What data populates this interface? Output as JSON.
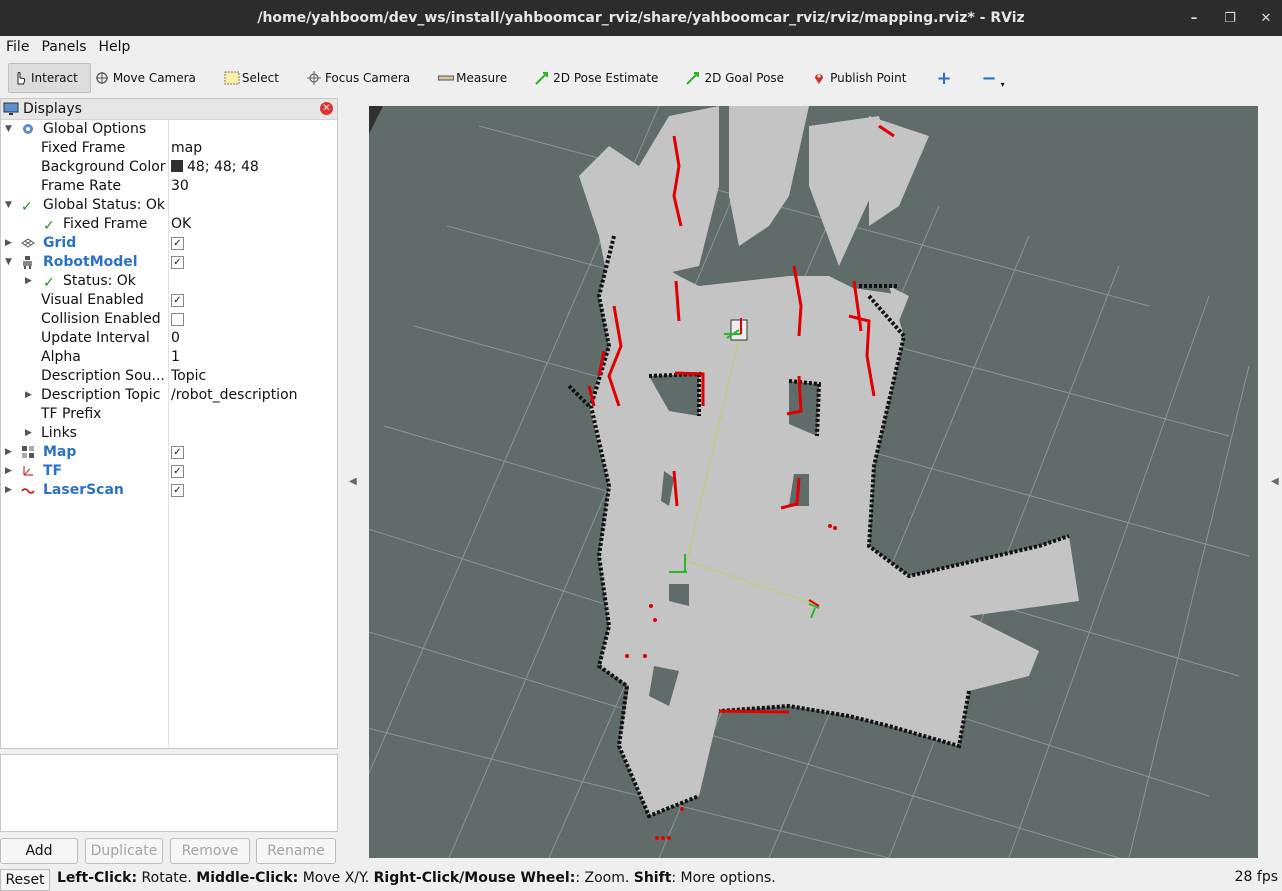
{
  "window": {
    "title": "/home/yahboom/dev_ws/install/yahboomcar_rviz/share/yahboomcar_rviz/rviz/mapping.rviz* - RViz",
    "buttons": {
      "minimize": "–",
      "restore": "❐",
      "close": "✕"
    }
  },
  "menu": [
    "File",
    "Panels",
    "Help"
  ],
  "toolbar": {
    "interact": "Interact",
    "move_camera": "Move Camera",
    "select": "Select",
    "focus_camera": "Focus Camera",
    "measure": "Measure",
    "pose_estimate": "2D Pose Estimate",
    "goal_pose": "2D Goal Pose",
    "publish_point": "Publish Point",
    "plus": "+",
    "minus": "−"
  },
  "displays": {
    "title": "Displays",
    "global_options": {
      "label": "Global Options",
      "fixed_frame_label": "Fixed Frame",
      "fixed_frame_value": "map",
      "bg_label": "Background Color",
      "bg_value": "48; 48; 48",
      "frame_rate_label": "Frame Rate",
      "frame_rate_value": "30"
    },
    "global_status": {
      "label": "Global Status: Ok",
      "fixed_frame_label": "Fixed Frame",
      "fixed_frame_value": "OK"
    },
    "grid": {
      "label": "Grid",
      "checked": true
    },
    "robot_model": {
      "label": "RobotModel",
      "checked": true,
      "status": "Status: Ok",
      "visual_label": "Visual Enabled",
      "visual_checked": true,
      "collision_label": "Collision Enabled",
      "collision_checked": false,
      "update_label": "Update Interval",
      "update_value": "0",
      "alpha_label": "Alpha",
      "alpha_value": "1",
      "desc_source_label": "Description Sou...",
      "desc_source_value": "Topic",
      "desc_topic_label": "Description Topic",
      "desc_topic_value": "/robot_description",
      "tf_prefix_label": "TF Prefix",
      "links_label": "Links"
    },
    "map": {
      "label": "Map",
      "checked": true
    },
    "tf": {
      "label": "TF",
      "checked": true
    },
    "laser_scan": {
      "label": "LaserScan",
      "checked": true
    }
  },
  "panel_buttons": {
    "add": "Add",
    "duplicate": "Duplicate",
    "remove": "Remove",
    "rename": "Rename"
  },
  "status": {
    "reset": "Reset",
    "hint_parts": [
      {
        "b": "Left-Click:",
        "t": " Rotate. "
      },
      {
        "b": "Middle-Click:",
        "t": " Move X/Y. "
      },
      {
        "b": "Right-Click/Mouse Wheel:",
        "t": ": Zoom. "
      },
      {
        "b": "Shift",
        "t": ": More options."
      }
    ],
    "fps": "28 fps"
  },
  "colors": {
    "viewport_bg": "#5f6c69",
    "free_space": "#bfbfbf",
    "obstacle": "#111111",
    "laser": "#e00000",
    "grid": "#8a9694",
    "link_blue": "#2a72c8"
  },
  "icons": {
    "settings": "gear-icon",
    "check": "check-icon",
    "grid": "grid-icon",
    "robot": "robot-icon",
    "map": "map-icon",
    "tf": "tf-icon",
    "laser": "laser-icon"
  }
}
